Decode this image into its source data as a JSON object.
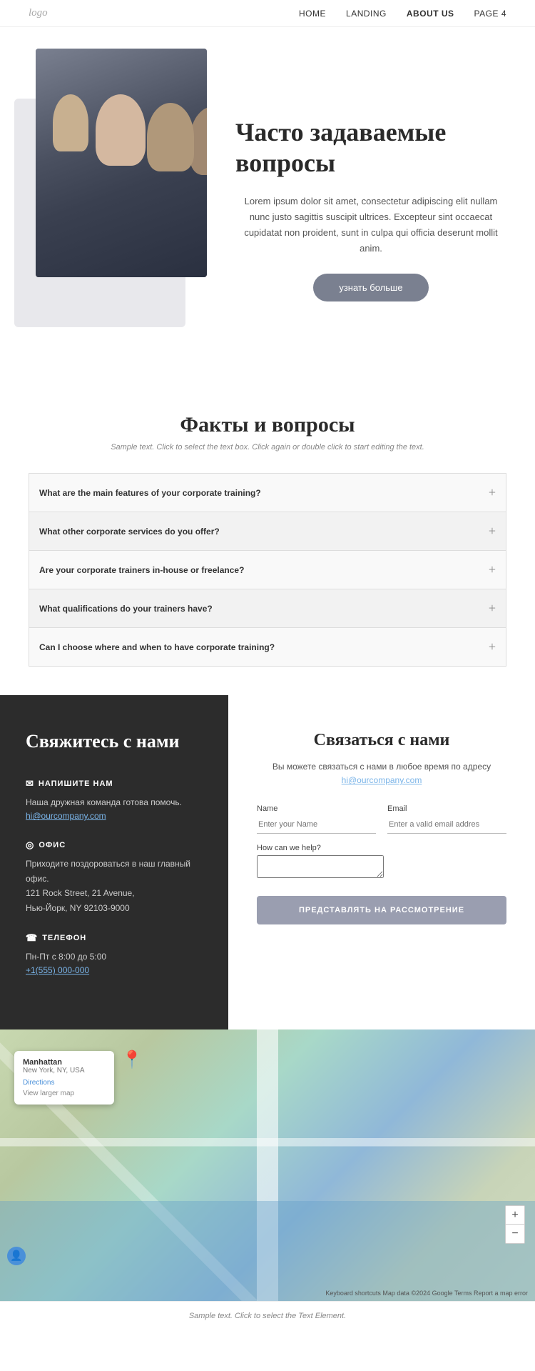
{
  "nav": {
    "logo": "logo",
    "links": [
      {
        "label": "HOME",
        "href": "#",
        "active": false
      },
      {
        "label": "LANDING",
        "href": "#",
        "active": false
      },
      {
        "label": "ABOUT US",
        "href": "#",
        "active": true
      },
      {
        "label": "PAGE 4",
        "href": "#",
        "active": false
      }
    ]
  },
  "hero": {
    "title": "Часто задаваемые вопросы",
    "description": "Lorem ipsum dolor sit amet, consectetur adipiscing elit nullam nunc justo sagittis suscipit ultrices. Excepteur sint occaecat cupidatat non proident, sunt in culpa qui officia deserunt mollit anim.",
    "button_label": "узнать больше"
  },
  "faq_section": {
    "title": "Факты и вопросы",
    "subtitle": "Sample text. Click to select the text box. Click again or double click to start editing the text.",
    "items": [
      {
        "question": "What are the main features of your corporate training?"
      },
      {
        "question": "What other corporate services do you offer?"
      },
      {
        "question": "Are your corporate trainers in-house or freelance?"
      },
      {
        "question": "What qualifications do your trainers have?"
      },
      {
        "question": "Can I choose where and when to have corporate training?"
      }
    ]
  },
  "contact_left": {
    "heading": "Свяжитесь с нами",
    "email_title": "НАПИШИТЕ НАМ",
    "email_desc": "Наша дружная команда готова помочь.",
    "email_link": "hi@ourcompany.com",
    "office_title": "ОФИС",
    "office_desc": "Приходите поздороваться в наш главный офис.",
    "office_address": "121 Rock Street, 21 Avenue,",
    "office_city": "Нью-Йорк, NY 92103-9000",
    "phone_title": "ТЕЛЕФОН",
    "phone_hours": "Пн-Пт с 8:00 до 5:00",
    "phone_number": "+1(555) 000-000"
  },
  "contact_form": {
    "heading": "Связаться с нами",
    "subtext": "Вы можете связаться с нами в любое время по адресу",
    "email_link": "hi@ourcompany.com",
    "name_label": "Name",
    "name_placeholder": "Enter your Name",
    "email_label": "Email",
    "email_placeholder": "Enter a valid email addres",
    "how_label": "How can we help?",
    "submit_label": "ПРЕДСТАВЛЯТЬ НА РАССМОТРЕНИЕ"
  },
  "map": {
    "popup_title": "Manhattan",
    "popup_subtitle": "New York, NY, USA",
    "directions_label": "Directions",
    "larger_map_label": "View larger map",
    "footer_text": "Keyboard shortcuts  Map data ©2024 Google  Terms  Report a map error"
  },
  "bottom_bar": {
    "text": "Sample text. Click to select the Text Element."
  }
}
